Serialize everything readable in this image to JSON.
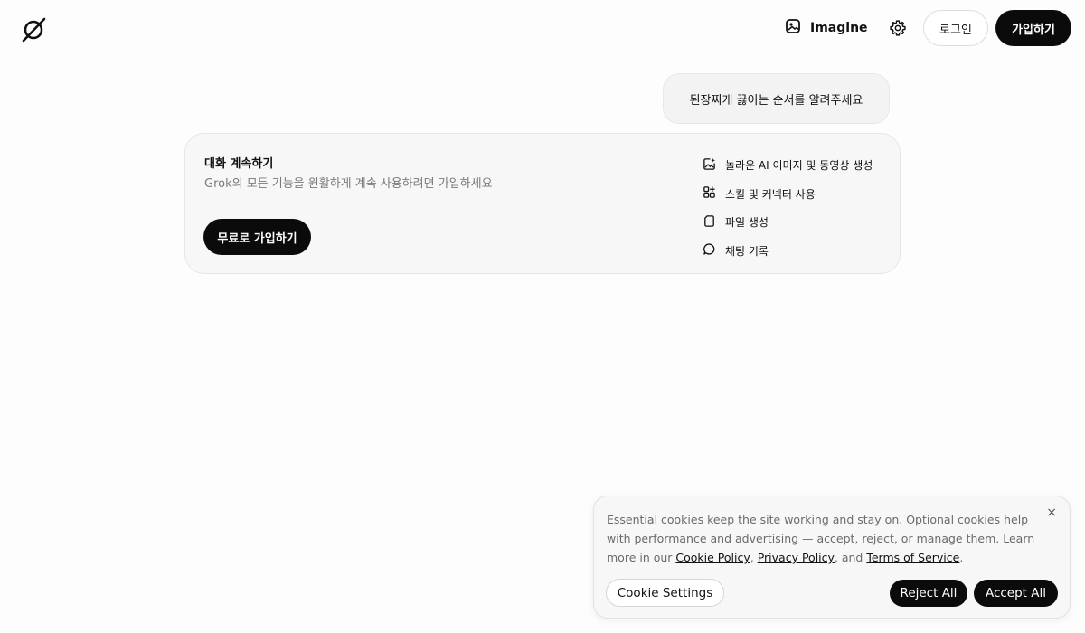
{
  "header": {
    "logo_icon": "grok-logo-icon",
    "imagine_label": "Imagine",
    "imagine_icon": "imagine-icon",
    "settings_icon": "gear-icon",
    "login_label": "로그인",
    "signup_label": "가입하기"
  },
  "chat": {
    "user_message": "된장찌개 끓이는 순서를 알려주세요"
  },
  "continue_card": {
    "title": "대화 계속하기",
    "subtitle": "Grok의 모든 기능을 원활하게 계속 사용하려면 가입하세요",
    "cta_label": "무료로 가입하기",
    "features": [
      {
        "icon": "image-sparkle-icon",
        "label": "놀라운 AI 이미지 및 동영상 생성"
      },
      {
        "icon": "apps-plus-icon",
        "label": "스킬 및 커넥터 사용"
      },
      {
        "icon": "file-icon",
        "label": "파일 생성"
      },
      {
        "icon": "chat-bubble-icon",
        "label": "채팅 기록"
      }
    ]
  },
  "cookie_banner": {
    "text_before": "Essential cookies keep the site working and stay on. Optional cookies help with performance and advertising — accept, reject, or manage them. Learn more in our ",
    "cookie_policy": "Cookie Policy",
    "sep1": ", ",
    "privacy_policy": "Privacy Policy",
    "sep2": ", and ",
    "terms": "Terms of Service",
    "text_after": ".",
    "close_symbol": "×",
    "settings_label": "Cookie Settings",
    "reject_label": "Reject All",
    "accept_label": "Accept All"
  },
  "colors": {
    "primary_button": "#0b0b0b",
    "background": "#fdfdfd",
    "muted_text": "#7a7a7a"
  }
}
